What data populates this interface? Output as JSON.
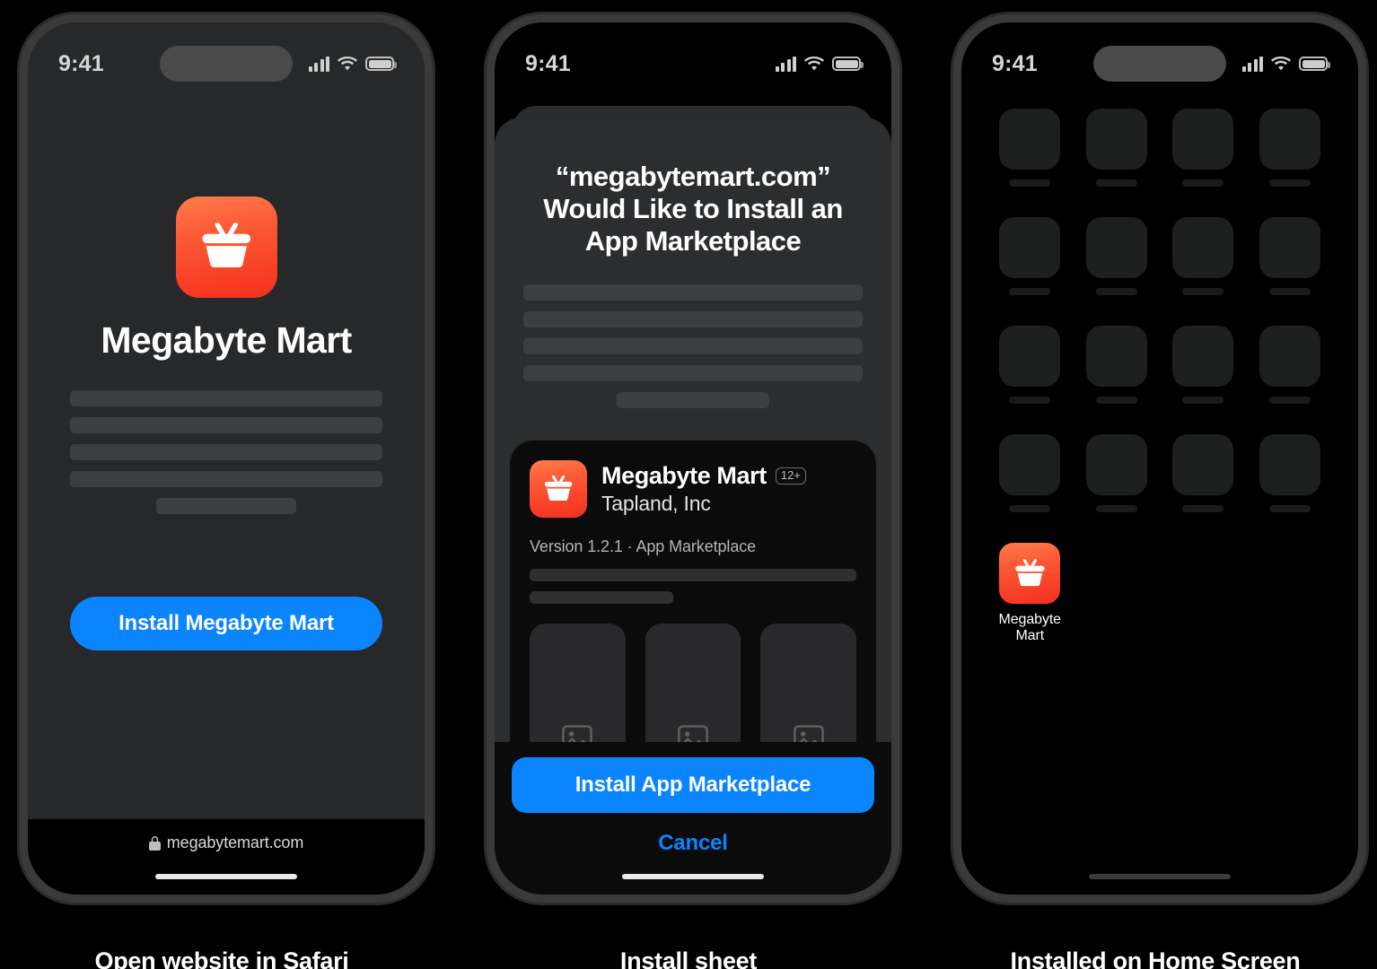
{
  "status_bar": {
    "time": "9:41",
    "icons": [
      "cellular-signal-icon",
      "wifi-icon",
      "battery-icon"
    ]
  },
  "colors": {
    "accent_blue": "#0a84ff",
    "icon_gradient_start": "#ff7d4d",
    "icon_gradient_end": "#f62f1e",
    "sheet_background": "#2b2d2e",
    "card_background": "#0b0b0b",
    "browser_background": "#262829",
    "home_background": "#000000",
    "skeleton": "#3b3f42"
  },
  "phone1_website": {
    "app_name": "Megabyte Mart",
    "app_icon": "shopping-basket-icon",
    "install_button_label": "Install Megabyte Mart",
    "url": "megabytemart.com",
    "url_lock_icon": "lock-icon",
    "placeholder_lines": 4,
    "placeholder_short_line": true
  },
  "phone2_install_sheet": {
    "title": "“megabytemart.com”\nWould Like to Install an\nApp Marketplace",
    "body_placeholder_lines": 4,
    "body_placeholder_short_line": true,
    "app_card": {
      "app_icon": "shopping-basket-icon",
      "app_name": "Megabyte Mart",
      "age_rating": "12+",
      "developer": "Tapland, Inc",
      "version_line": "Version 1.2.1 · App Marketplace",
      "detail_placeholder_lines": 2,
      "screenshots": [
        {
          "placeholder_icon": "image-placeholder-icon"
        },
        {
          "placeholder_icon": "image-placeholder-icon"
        },
        {
          "placeholder_icon": "image-placeholder-icon"
        }
      ]
    },
    "install_button_label": "Install App Marketplace",
    "cancel_button_label": "Cancel"
  },
  "phone3_home_screen": {
    "placeholder_icon_rows": 4,
    "placeholder_icon_columns": 4,
    "installed_app": {
      "icon": "shopping-basket-icon",
      "label": "Megabyte Mart"
    }
  },
  "captions": {
    "caption1": "Open website in Safari",
    "caption2": "Install sheet",
    "caption3": "Installed on Home Screen"
  }
}
